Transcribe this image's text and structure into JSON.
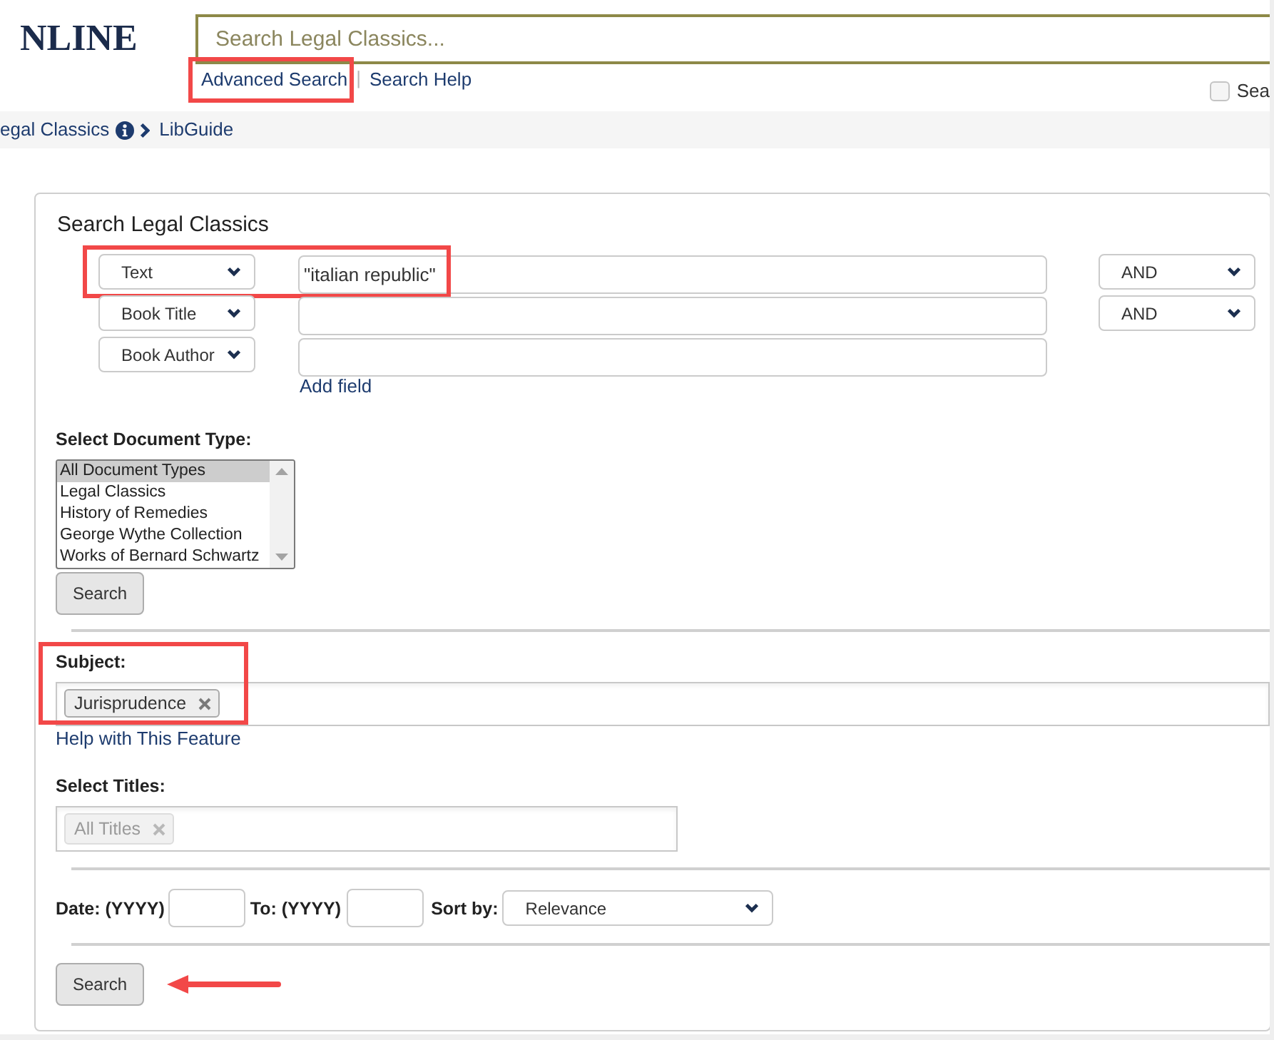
{
  "header": {
    "logo": "NLINE",
    "search": {
      "placeholder": "Search Legal Classics..."
    },
    "links": [
      {
        "label": "Advanced Search",
        "highlighted": true
      },
      {
        "label": "Search Help",
        "highlighted": false
      }
    ],
    "separator": "|",
    "option": {
      "label": "Sea",
      "checked": false
    }
  },
  "breadcrumb": [
    {
      "label": "egal Classics",
      "info": true
    },
    {
      "label": "LibGuide"
    }
  ],
  "form": {
    "title": "Search Legal Classics",
    "rows": [
      {
        "field": "Text",
        "value": "\"italian republic\"",
        "operator": "AND",
        "highlighted": true
      },
      {
        "field": "Book Title",
        "operator": "AND",
        "highlighted": false
      },
      {
        "field": "Book Author",
        "highlighted": false
      }
    ],
    "add_field": "Add field",
    "document_type": {
      "label": "Select Document Type:",
      "options": [
        {
          "label": "All Document Types",
          "selected": true
        },
        {
          "label": "Legal Classics",
          "selected": false
        },
        {
          "label": "History of Remedies",
          "selected": false
        },
        {
          "label": "George Wythe Collection",
          "selected": false
        },
        {
          "label": "Works of Bernard Schwartz",
          "selected": false
        }
      ],
      "button": "Search"
    },
    "subject": {
      "label": "Subject:",
      "tags": [
        "Jurisprudence"
      ],
      "highlighted": true,
      "help": "Help with This Feature"
    },
    "titles": {
      "label": "Select Titles:",
      "tags": [
        "All Titles"
      ],
      "disabled": true
    },
    "date_from": {
      "label": "Date: (YYYY)"
    },
    "date_to": {
      "label": "To: (YYYY)"
    },
    "sort": {
      "label": "Sort by:",
      "value": "Relevance"
    },
    "submit": {
      "label": "Search",
      "arrow": true
    }
  }
}
